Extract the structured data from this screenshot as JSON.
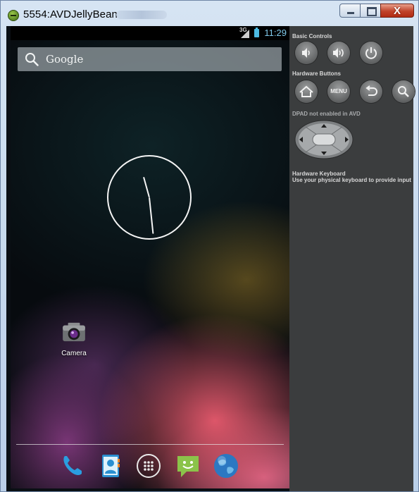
{
  "window": {
    "title": "5554:AVDJellyBean",
    "close_label": "X"
  },
  "statusbar": {
    "network": "3G",
    "time": "11:29"
  },
  "search": {
    "text": "Google"
  },
  "clock": {
    "hour": 11,
    "minute": 29
  },
  "desktop": {
    "apps": [
      {
        "label": "Camera",
        "icon": "camera-icon"
      }
    ]
  },
  "dock": {
    "items": [
      {
        "icon": "phone-icon"
      },
      {
        "icon": "contacts-icon"
      },
      {
        "icon": "app-drawer-icon"
      },
      {
        "icon": "messaging-icon"
      },
      {
        "icon": "browser-icon"
      }
    ]
  },
  "panel": {
    "basic_controls": "Basic Controls",
    "hardware_buttons": "Hardware Buttons",
    "menu_label": "MENU",
    "dpad_note": "DPAD not enabled in AVD",
    "keyboard_title": "Hardware Keyboard",
    "keyboard_note": "Use your physical keyboard to provide input"
  },
  "colors": {
    "panel_bg": "#3b3d3e",
    "accent": "#7fc8e8"
  }
}
